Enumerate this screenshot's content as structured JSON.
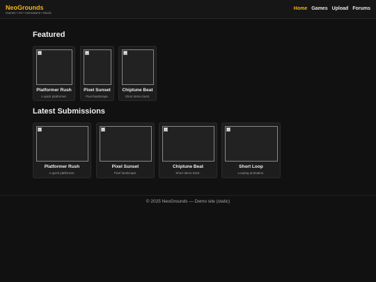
{
  "header": {
    "brand": "NeoGrounds",
    "tagline": "Games • Art • Animations • Music",
    "nav": [
      {
        "label": "Home",
        "active": true
      },
      {
        "label": "Games",
        "active": false
      },
      {
        "label": "Upload",
        "active": false
      },
      {
        "label": "Forums",
        "active": false
      }
    ]
  },
  "featured": {
    "title": "Featured",
    "cards": [
      {
        "title": "Platformer Rush",
        "desc": "A quick platformer."
      },
      {
        "title": "Pixel Sunset",
        "desc": "Pixel landscape."
      },
      {
        "title": "Chiptune Beat",
        "desc": "Short demo track."
      }
    ]
  },
  "latest": {
    "title": "Latest Submissions",
    "cards": [
      {
        "title": "Platformer Rush",
        "desc": "A quick platformer."
      },
      {
        "title": "Pixel Sunset",
        "desc": "Pixel landscape."
      },
      {
        "title": "Chiptune Beat",
        "desc": "Short demo track."
      },
      {
        "title": "Short Loop",
        "desc": "Looping animation."
      }
    ]
  },
  "footer": {
    "text": "© 2025 NeoGrounds — Demo site (static)"
  },
  "colors": {
    "accent": "#f4b618",
    "background": "#111111",
    "card": "#1d1d1d"
  }
}
